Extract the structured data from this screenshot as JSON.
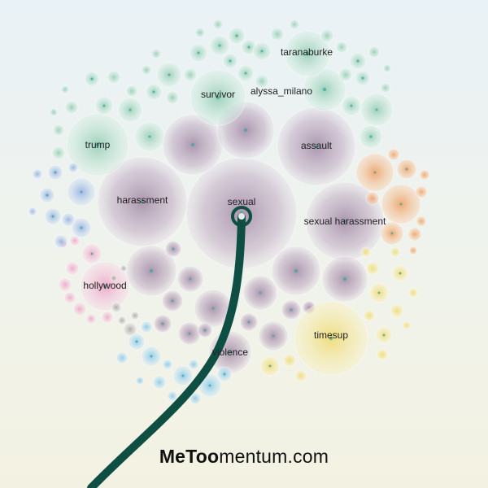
{
  "labels": {
    "taranaburke": "taranaburke",
    "alyssa_milano": "alyssa_milano",
    "survivor": "survivor",
    "trump": "trump",
    "assault": "assault",
    "harassment": "harassment",
    "sexual": "sexual",
    "sexual_harassment": "sexual harassment",
    "hollywood": "hollywood",
    "timesup": "timesup",
    "violence": "violence"
  },
  "brand": {
    "bold": "MeToo",
    "regular": "mentum.com"
  },
  "colors": {
    "purple_cluster": "#b9a3bc",
    "green_cluster": "#a9d6c1",
    "orange_cluster": "#f2b27c",
    "yellow_cluster": "#f3e38a",
    "pink_cluster": "#f2b8d2",
    "blue_cluster": "#a8c2ea",
    "cyan_cluster": "#9fd3ee",
    "stem": "#0f4f43"
  }
}
